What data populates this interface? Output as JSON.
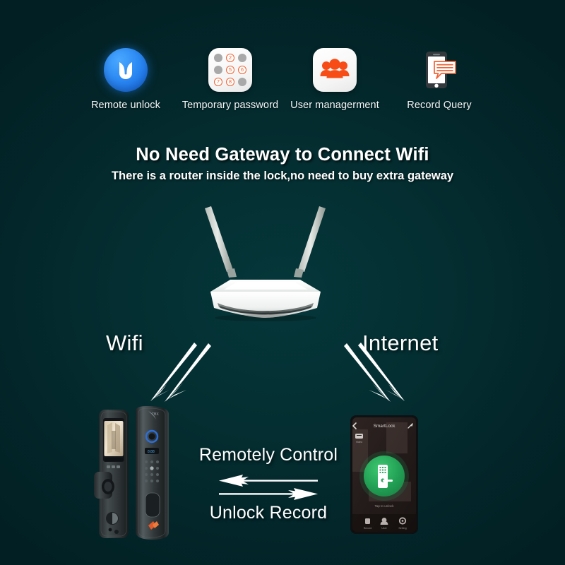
{
  "theme": {
    "background_color": "#03282a",
    "text_color": "#ffffff",
    "accent_blue": "#2e8cf5",
    "accent_orange": "#f26232",
    "accent_green": "#27a85a"
  },
  "features": [
    {
      "icon": "tuya-app-icon",
      "label": "Remote unlock",
      "icon_color": "#2e8cf5"
    },
    {
      "icon": "keypad-icon",
      "label": "Temporary password",
      "icon_color": "#f26232",
      "keypad": [
        {
          "digit": "",
          "active": false
        },
        {
          "digit": "2",
          "active": true
        },
        {
          "digit": "",
          "active": false
        },
        {
          "digit": "",
          "active": false
        },
        {
          "digit": "5",
          "active": true
        },
        {
          "digit": "6",
          "active": true
        },
        {
          "digit": "7",
          "active": true
        },
        {
          "digit": "8",
          "active": true
        },
        {
          "digit": "",
          "active": false
        }
      ]
    },
    {
      "icon": "users-group-icon",
      "label": "User managerment",
      "icon_color": "#f74c16"
    },
    {
      "icon": "phone-message-icon",
      "label": "Record Query",
      "icon_color": "#f26232"
    }
  ],
  "headline": "No Need Gateway to Connect Wifi",
  "subheadline": "There is a router inside the lock,no need to buy extra gateway",
  "connection": {
    "left_label": "Wifi",
    "right_label": "Internet"
  },
  "flow": {
    "top_label": "Remotely Control",
    "bottom_label": "Unlock Record"
  },
  "devices": {
    "lock": {
      "name": "smart-door-lock",
      "front_panel": "camera-display-panel",
      "rear_panel": "keypad-handle-panel"
    },
    "phone": {
      "name": "smartphone-app",
      "app_title": "SmartLock",
      "unlock_button": "unlock-circle-button",
      "nav_items": [
        "Record",
        "User",
        "Setting"
      ]
    },
    "router": {
      "name": "wifi-router",
      "antennas": 2
    }
  }
}
